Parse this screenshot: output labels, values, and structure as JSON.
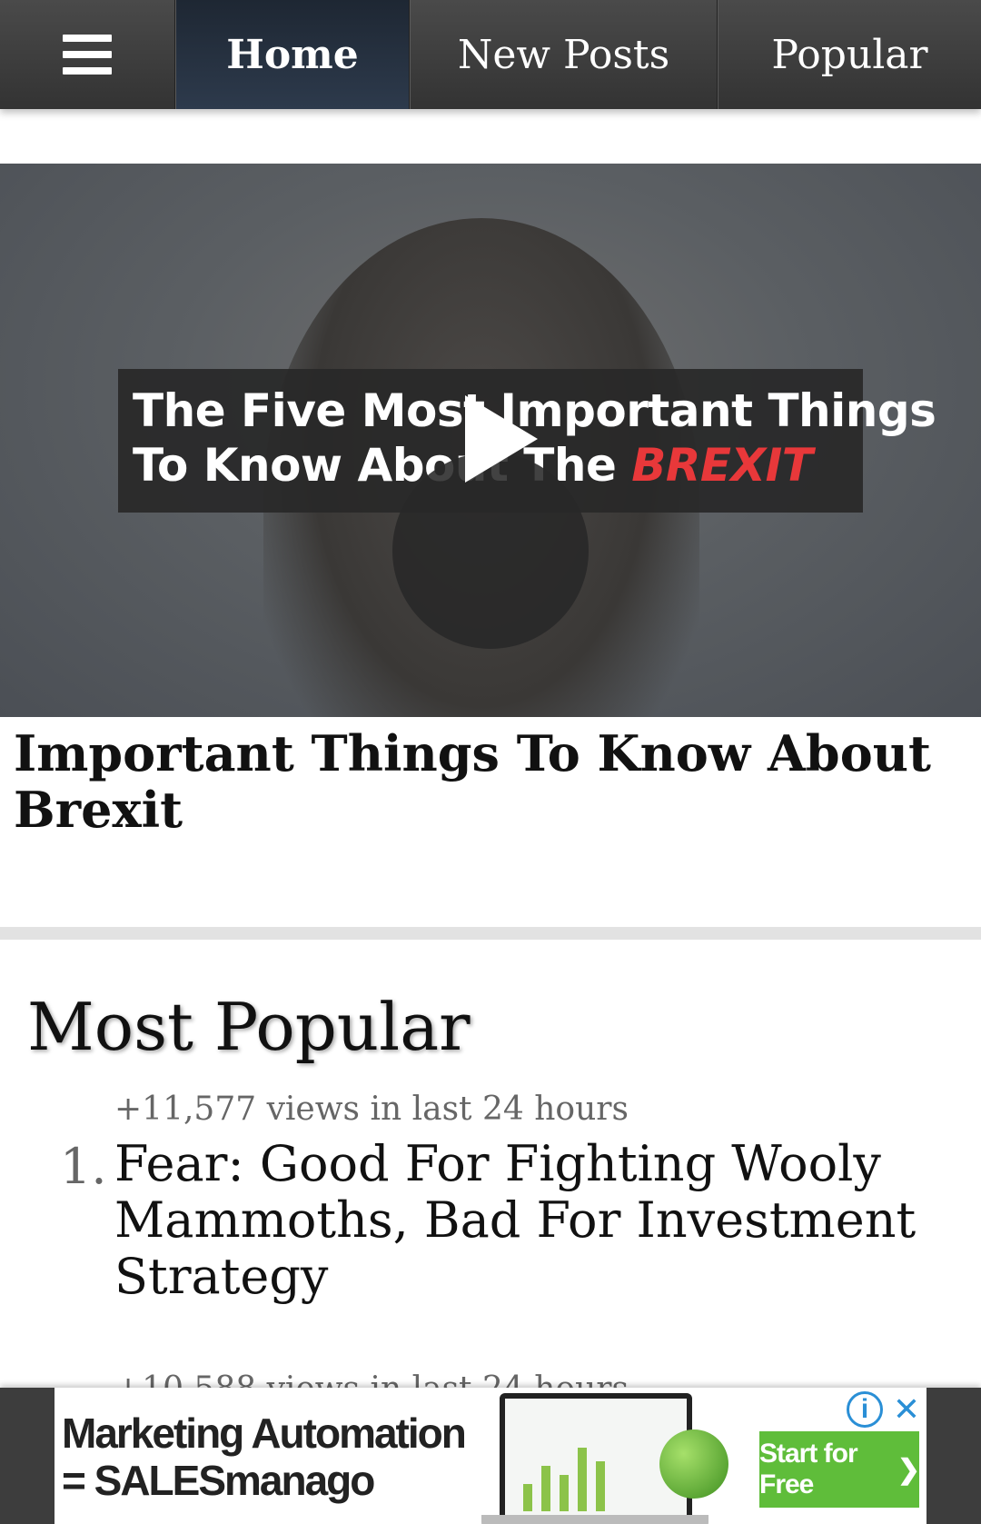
{
  "nav": {
    "menu_icon": "hamburger-menu-icon",
    "tabs": [
      {
        "label": "Home",
        "active": true
      },
      {
        "label": "New Posts",
        "active": false
      },
      {
        "label": "Popular",
        "active": false
      }
    ]
  },
  "video": {
    "banner_line1": "The Five Most Important Things",
    "banner_line2_prefix": "To Know About The ",
    "banner_highlight": "BREXIT",
    "highlight_color": "#e8383a",
    "play_icon": "play-icon",
    "title": "Important Things To Know About Brexit"
  },
  "most_popular": {
    "heading": "Most Popular",
    "items": [
      {
        "rank": "1.",
        "views": "+11,577 views in last 24 hours",
        "title": "Fear: Good For Fighting Wooly Mammoths, Bad For Investment Strategy"
      },
      {
        "views": "+10,588 views in last 24 hours"
      }
    ]
  },
  "ad": {
    "headline_line1": "Marketing Automation",
    "headline_line2": "= SALESmanago",
    "cta": "Start for Free",
    "cta_color": "#5fbd3a",
    "info_icon": "info-icon",
    "close_icon": "close-icon"
  }
}
